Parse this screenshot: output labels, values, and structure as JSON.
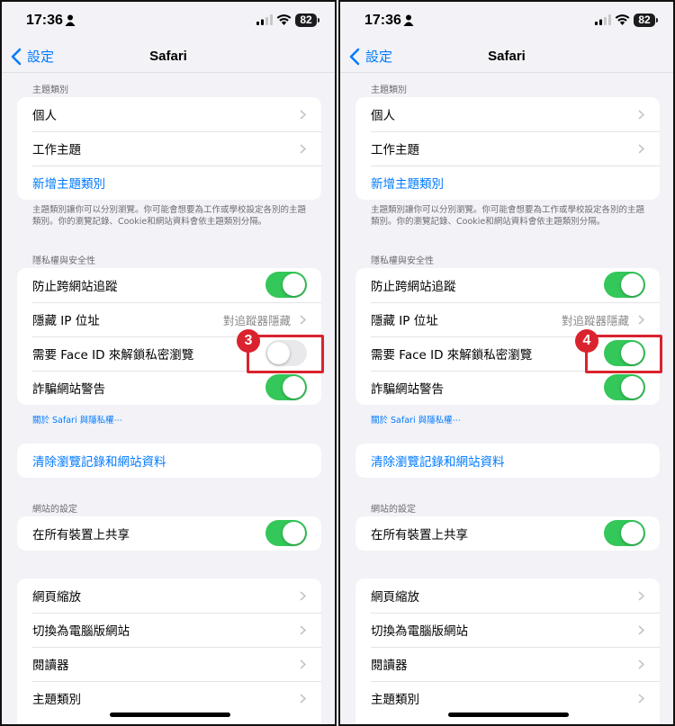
{
  "status": {
    "time": "17:36",
    "battery": "82"
  },
  "nav": {
    "back_label": "設定",
    "title": "Safari"
  },
  "profiles": {
    "header": "主題類別",
    "items": [
      {
        "label": "個人"
      },
      {
        "label": "工作主題"
      }
    ],
    "add_label": "新增主題類別",
    "footnote": "主題類別讓你可以分別瀏覽。你可能會想要為工作或學校設定各別的主題類別。你的瀏覽記錄、Cookie和網站資料會依主題類別分隔。"
  },
  "privacy": {
    "header": "隱私權與安全性",
    "prevent_tracking": {
      "label": "防止跨網站追蹤",
      "on": true
    },
    "hide_ip": {
      "label": "隱藏 IP 位址",
      "value": "對追蹤器隱藏"
    },
    "faceid": {
      "label": "需要 Face ID 來解鎖私密瀏覽"
    },
    "fraud_warning": {
      "label": "詐騙網站警告",
      "on": true
    },
    "about_link": "關於 Safari 與隱私權⋯"
  },
  "clear": {
    "label": "清除瀏覽記錄和網站資料"
  },
  "website_settings": {
    "header": "網站的設定",
    "share_label": "在所有裝置上共享"
  },
  "more": {
    "items": [
      {
        "label": "網頁縮放"
      },
      {
        "label": "切換為電腦版網站"
      },
      {
        "label": "閱讀器"
      },
      {
        "label": "主題類別"
      }
    ]
  },
  "panels": [
    {
      "step": "3",
      "faceid_on": false
    },
    {
      "step": "4",
      "faceid_on": true
    }
  ],
  "colors": {
    "accent": "#007aff",
    "toggle_on": "#34c759",
    "callout": "#d9232e"
  }
}
